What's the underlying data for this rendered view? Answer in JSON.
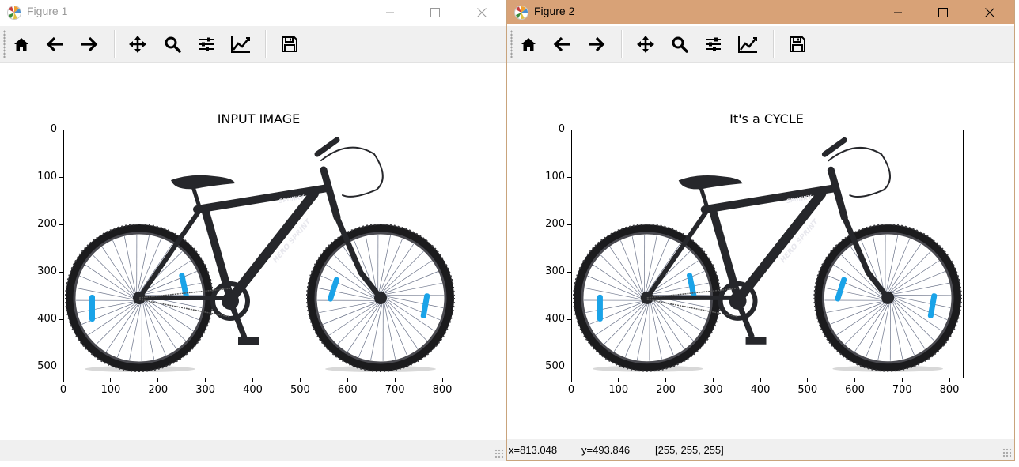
{
  "windows": [
    {
      "title": "Figure 1",
      "axes_title": "INPUT IMAGE",
      "status": {
        "x": "",
        "y": "",
        "pixel": ""
      },
      "active": false
    },
    {
      "title": "Figure 2",
      "axes_title": "It's a CYCLE",
      "status": {
        "x": "x=813.048",
        "y": "y=493.846",
        "pixel": "[255, 255, 255]"
      },
      "active": true
    }
  ],
  "toolbar": {
    "buttons": [
      {
        "name": "home",
        "icon": "home-icon"
      },
      {
        "name": "back",
        "icon": "arrow-left-icon"
      },
      {
        "name": "forward",
        "icon": "arrow-right-icon"
      },
      {
        "name": "pan",
        "icon": "move-icon"
      },
      {
        "name": "zoom",
        "icon": "magnifier-icon"
      },
      {
        "name": "configure-subplots",
        "icon": "sliders-icon"
      },
      {
        "name": "edit-axis",
        "icon": "line-chart-icon"
      },
      {
        "name": "save",
        "icon": "floppy-disk-icon"
      }
    ]
  },
  "axes": {
    "xticks": [
      "0",
      "100",
      "200",
      "300",
      "400",
      "500",
      "600",
      "700",
      "800"
    ],
    "yticks": [
      "0",
      "100",
      "200",
      "300",
      "400",
      "500"
    ],
    "xlim": [
      0,
      830
    ],
    "ylim": [
      525,
      0
    ]
  },
  "image": {
    "content": "bicycle photograph",
    "frame_text": "HERO SPRINT",
    "top_tube_text": "SPUNKY",
    "colors": {
      "frame": "#26272b",
      "reflector": "#1aa3e8",
      "tire": "#1b1b1d",
      "background": "#ffffff"
    }
  },
  "colors": {
    "active_titlebar": "#d8a277",
    "inactive_title_text": "#999999",
    "toolbar_bg": "#f0f0f0"
  }
}
